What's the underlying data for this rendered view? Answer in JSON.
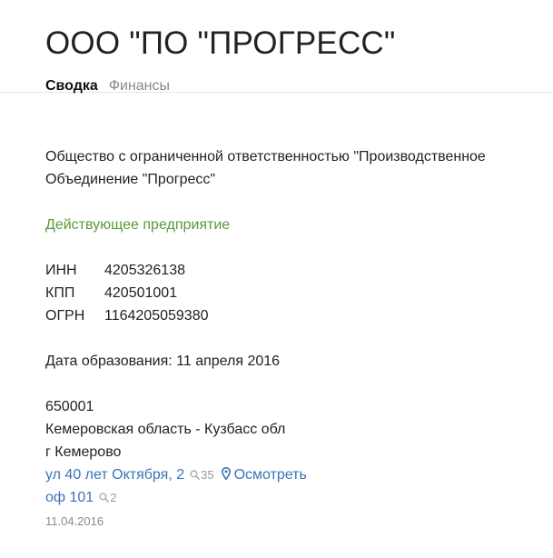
{
  "header": {
    "title": "ООО \"ПО \"ПРОГРЕСС\"",
    "tabs": [
      {
        "label": "Сводка",
        "active": true
      },
      {
        "label": "Финансы",
        "active": false
      }
    ]
  },
  "company": {
    "full_name": "Общество с ограниченной ответственностью \"Производственное Объединение \"Прогресс\"",
    "status": "Действующее предприятие",
    "codes": [
      {
        "label": "ИНН",
        "value": "4205326138"
      },
      {
        "label": "КПП",
        "value": "420501001"
      },
      {
        "label": "ОГРН",
        "value": "1164205059380"
      }
    ],
    "founded": "Дата образования: 11 апреля 2016"
  },
  "address": {
    "postcode": "650001",
    "region": "Кемеровская область - Кузбасс обл",
    "city": "г Кемерово",
    "street_link": "ул 40 лет Октября, 2",
    "street_count": "35",
    "view_link": "Осмотреть",
    "office_link": "оф 101",
    "office_count": "2",
    "date": "11.04.2016"
  },
  "colors": {
    "status": "#5a9a3a",
    "link": "#3a74b8",
    "muted": "#8a8a8a"
  },
  "icons": {
    "search": "search-icon",
    "pin": "map-pin-icon"
  }
}
